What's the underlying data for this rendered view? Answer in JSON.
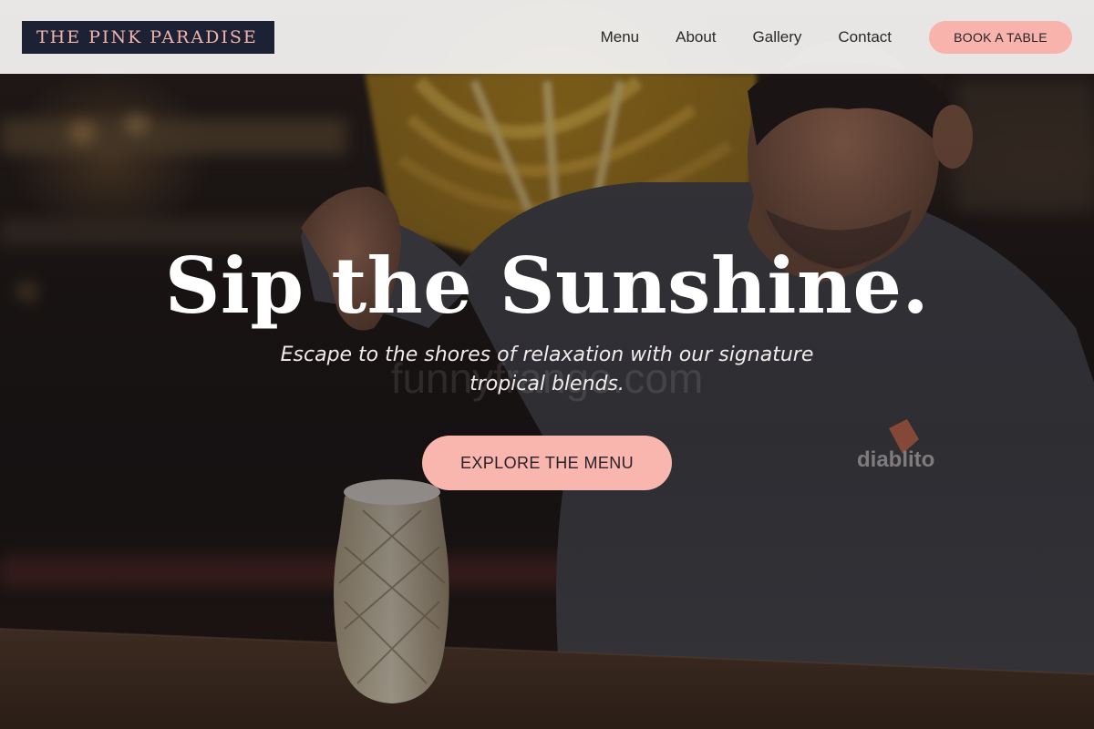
{
  "brand": {
    "logo_text": "THE PINK PARADISE"
  },
  "nav": {
    "links": [
      "Menu",
      "About",
      "Gallery",
      "Contact"
    ],
    "cta_label": "BOOK A TABLE"
  },
  "hero": {
    "headline": "Sip the Sunshine.",
    "subheadline": "Escape to the shores of relaxation with our signature tropical blends.",
    "cta_label": "EXPLORE THE MENU",
    "watermark": "funnyfrango.com",
    "shirt_logo_text": "diablito"
  },
  "colors": {
    "accent_pink": "#f7b3ac",
    "logo_bg": "#1c2233",
    "logo_text": "#f3b3ad"
  }
}
